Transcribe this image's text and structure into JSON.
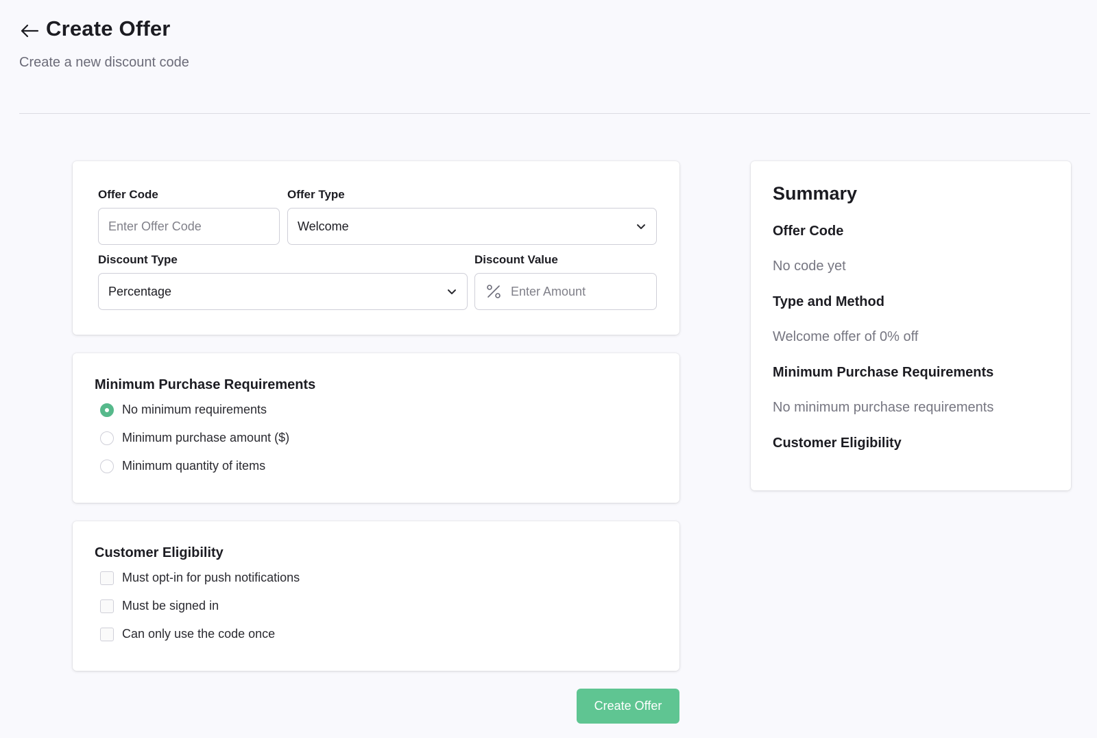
{
  "header": {
    "title": "Create Offer",
    "subtitle": "Create a new discount code"
  },
  "offer_details": {
    "offer_code": {
      "label": "Offer Code",
      "value": "",
      "placeholder": "Enter Offer Code"
    },
    "offer_type": {
      "label": "Offer Type",
      "selected": "Welcome"
    },
    "discount_type": {
      "label": "Discount Type",
      "selected": "Percentage"
    },
    "discount_value": {
      "label": "Discount Value",
      "value": "",
      "placeholder": "Enter Amount",
      "prefix_icon": "percent-icon"
    }
  },
  "minimum_purchase": {
    "title": "Minimum Purchase Requirements",
    "options": [
      {
        "label": "No minimum requirements",
        "checked": true
      },
      {
        "label": "Minimum purchase amount ($)",
        "checked": false
      },
      {
        "label": "Minimum quantity of items",
        "checked": false
      }
    ]
  },
  "customer_eligibility": {
    "title": "Customer Eligibility",
    "options": [
      {
        "label": "Must opt-in for push notifications",
        "checked": false
      },
      {
        "label": "Must be signed in",
        "checked": false
      },
      {
        "label": "Can only use the code once",
        "checked": false
      }
    ]
  },
  "summary": {
    "title": "Summary",
    "offer_code_heading": "Offer Code",
    "offer_code_value": "No code yet",
    "type_method_heading": "Type and Method",
    "type_method_value": "Welcome offer of 0% off",
    "min_purchase_heading": "Minimum Purchase Requirements",
    "min_purchase_value": "No minimum purchase requirements",
    "eligibility_heading": "Customer Eligibility"
  },
  "actions": {
    "create_label": "Create Offer"
  },
  "colors": {
    "accent": "#56b98b",
    "button": "#5fc592",
    "background": "#f9f9fd"
  }
}
